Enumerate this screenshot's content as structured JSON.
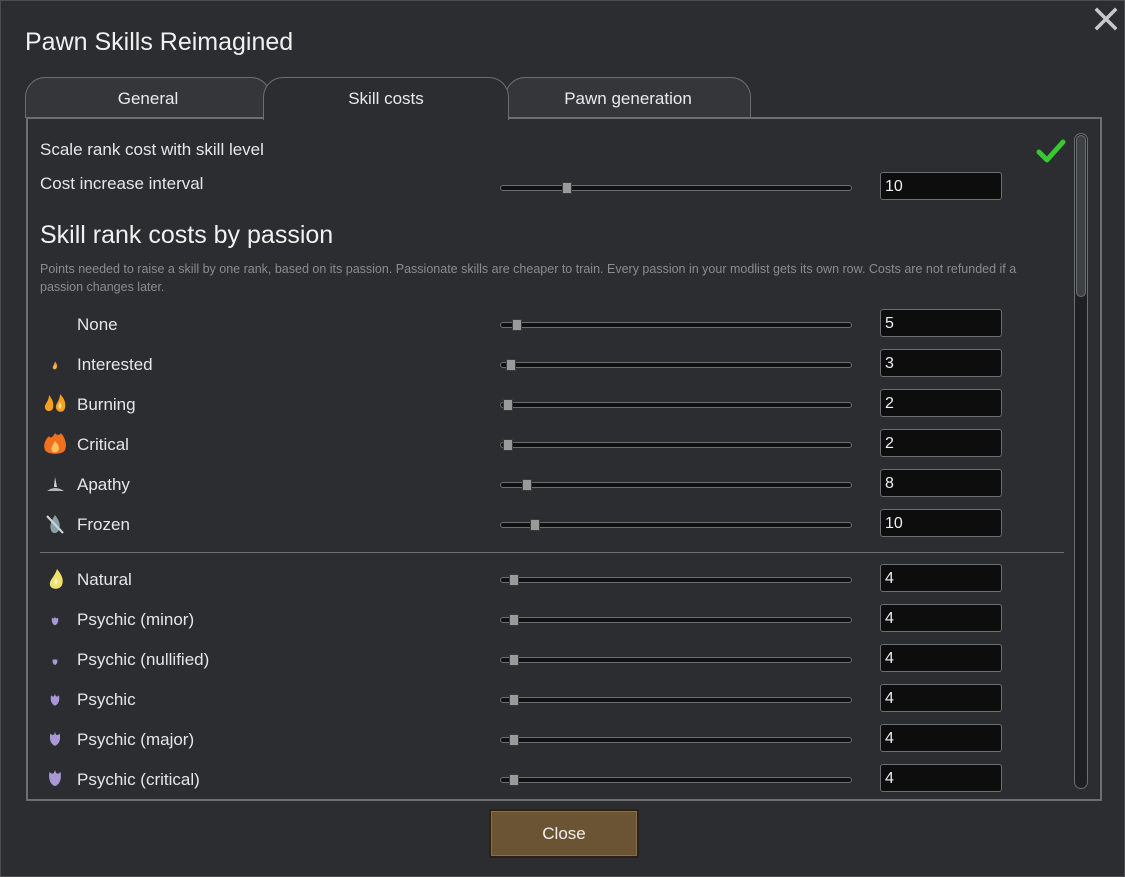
{
  "window": {
    "title": "Pawn Skills Reimagined"
  },
  "tabs": [
    {
      "label": "General",
      "active": false
    },
    {
      "label": "Skill costs",
      "active": true
    },
    {
      "label": "Pawn generation",
      "active": false
    }
  ],
  "settings": {
    "scale_rank_label": "Scale rank cost with skill level",
    "scale_rank_checked": true,
    "cost_interval_label": "Cost increase interval",
    "cost_interval_value": "10",
    "cost_interval_fraction": 0.18
  },
  "section": {
    "heading": "Skill rank costs by passion",
    "description": "Points needed to raise a skill by one rank, based on its passion. Passionate skills are cheaper to train. Every passion in your modlist gets its own row. Costs are not refunded if a passion changes later."
  },
  "passions": [
    {
      "label": "None",
      "value": "5",
      "fraction": 0.035,
      "icon": "none",
      "color": ""
    },
    {
      "label": "Interested",
      "value": "3",
      "fraction": 0.018,
      "icon": "flame-small-icon",
      "color": "#f0a030"
    },
    {
      "label": "Burning",
      "value": "2",
      "fraction": 0.008,
      "icon": "flame-double-icon",
      "color": "#f5a020"
    },
    {
      "label": "Critical",
      "value": "2",
      "fraction": 0.008,
      "icon": "flame-large-icon",
      "color": "#f07020"
    },
    {
      "label": "Apathy",
      "value": "8",
      "fraction": 0.065,
      "icon": "apathy-icon",
      "color": "#b8b8b8"
    },
    {
      "label": "Frozen",
      "value": "10",
      "fraction": 0.088,
      "icon": "frozen-icon",
      "color": "#8aa0a8"
    }
  ],
  "passions_extra": [
    {
      "label": "Natural",
      "value": "4",
      "fraction": 0.027,
      "icon": "natural-flame-icon",
      "color": "#f0e070"
    },
    {
      "label": "Psychic (minor)",
      "value": "4",
      "fraction": 0.027,
      "icon": "psychic-flame-icon",
      "color": "#a898d8"
    },
    {
      "label": "Psychic (nullified)",
      "value": "4",
      "fraction": 0.027,
      "icon": "psychic-flame-icon",
      "color": "#a898d8"
    },
    {
      "label": "Psychic",
      "value": "4",
      "fraction": 0.027,
      "icon": "psychic-flame-icon",
      "color": "#a898d8"
    },
    {
      "label": "Psychic (major)",
      "value": "4",
      "fraction": 0.027,
      "icon": "psychic-flame-icon",
      "color": "#a898d8"
    },
    {
      "label": "Psychic (critical)",
      "value": "4",
      "fraction": 0.027,
      "icon": "psychic-flame-icon",
      "color": "#a898d8"
    }
  ],
  "footer": {
    "close_label": "Close"
  },
  "colors": {
    "check": "#38c830",
    "button": "#6b5434"
  }
}
